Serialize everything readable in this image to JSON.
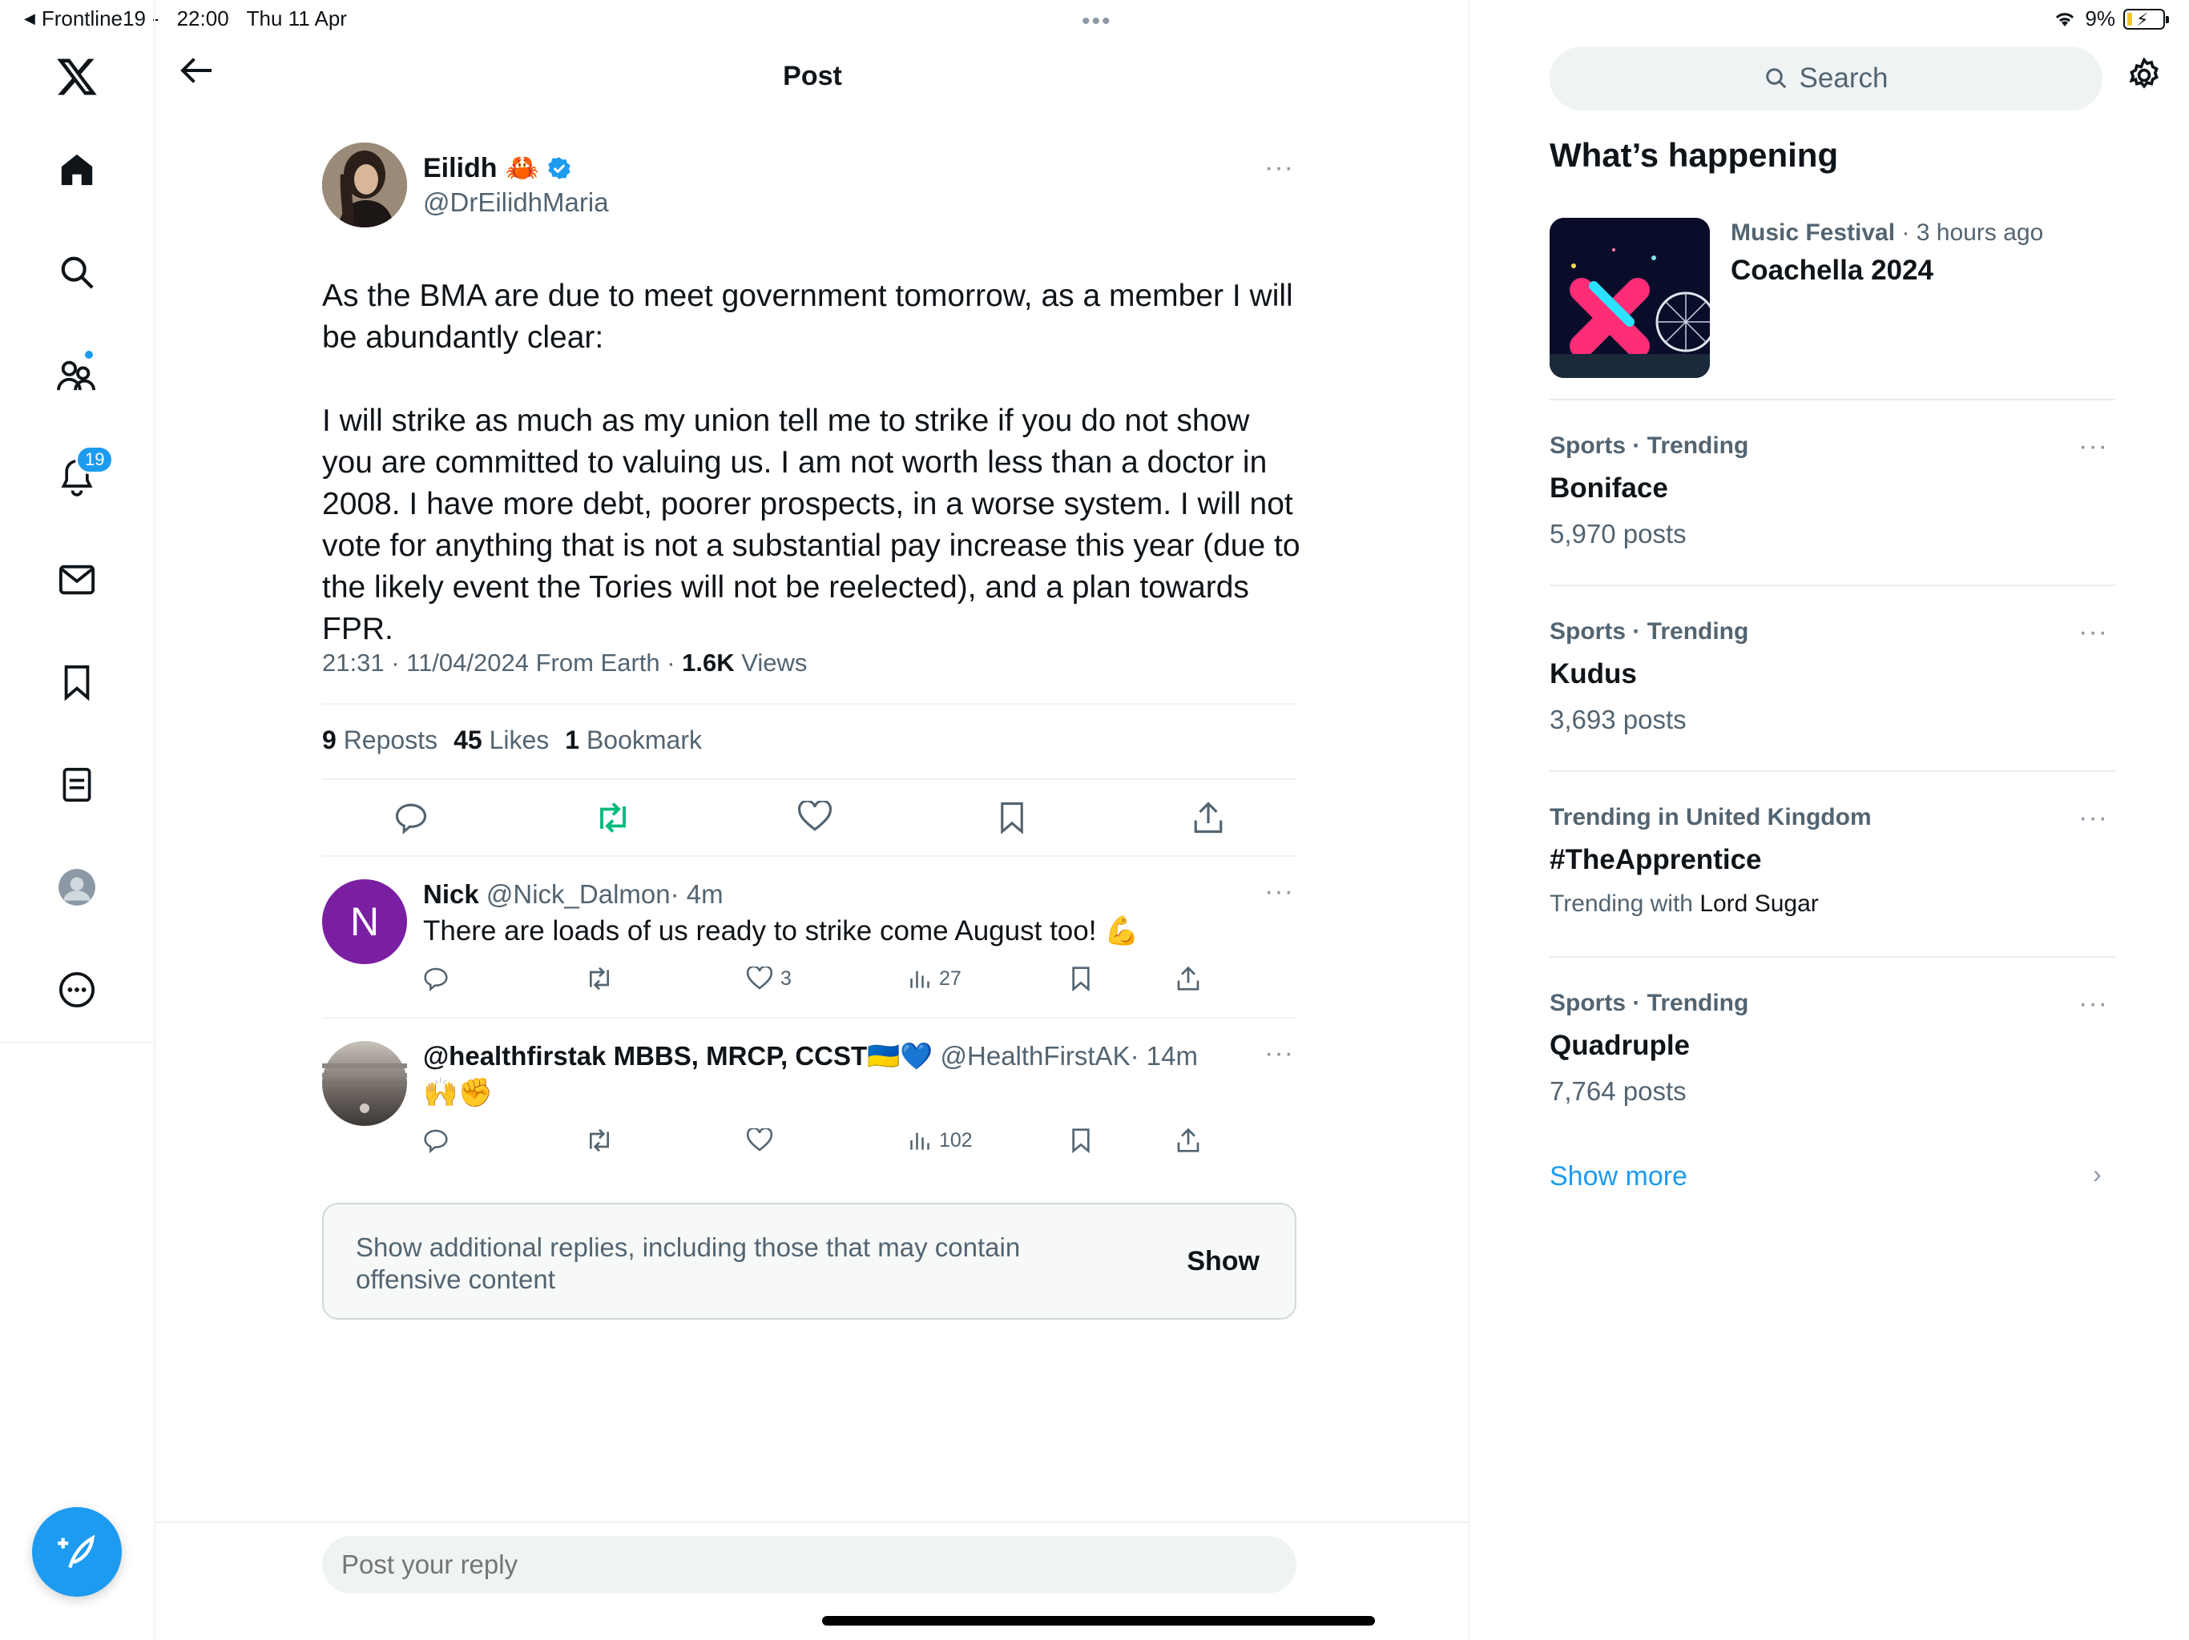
{
  "status_bar": {
    "back_app": "Frontline19",
    "separator": "-",
    "time": "22:00",
    "date": "Thu 11 Apr",
    "battery": "9%"
  },
  "nav": {
    "notifications_badge": "19"
  },
  "header": {
    "title": "Post"
  },
  "post": {
    "author_name": "Eilidh",
    "author_emoji": "🦀",
    "author_handle": "@DrEilidhMaria",
    "paragraphs": [
      "As the BMA are due to meet government tomorrow, as a member I will be abundantly clear:",
      "I will strike as much as my union tell me to strike if you do not show you are committed to valuing us. I am not worth less than a doctor in 2008. I have more debt, poorer prospects, in a worse system. I will not vote for anything that is not a substantial pay increase this year (due to the likely event the Tories will not be reelected), and a plan towards FPR."
    ],
    "meta_time": "21:31 · 11/04/2024 From Earth · ",
    "meta_views": "1.6K",
    "meta_views_label": " Views",
    "reposts_count": "9",
    "reposts_label": "Reposts",
    "likes_count": "45",
    "likes_label": "Likes",
    "bookmarks_count": "1",
    "bookmarks_label": "Bookmark"
  },
  "replies": [
    {
      "initial": "N",
      "name": "Nick",
      "handle": "@Nick_Dalmon",
      "time": "· 4m",
      "text": "There are loads of us ready to strike come August too! 💪",
      "likes": "3",
      "views": "27"
    },
    {
      "name": "@healthfirstak MBBS, MRCP, CCST🇺🇦💙",
      "handle": "@HealthFirstAK",
      "time": "· 14m",
      "text": "🙌✊",
      "likes": "",
      "views": "102"
    }
  ],
  "show_additional": {
    "text": "Show additional replies, including those that may contain offensive content",
    "button": "Show"
  },
  "reply_input": {
    "placeholder": "Post your reply"
  },
  "sidebar": {
    "search_placeholder": "Search",
    "whats_happening": "What’s happening",
    "featured": {
      "category": "Music Festival",
      "time": " · 3 hours ago",
      "title": "Coachella 2024"
    },
    "trends": [
      {
        "category": "Sports · Trending",
        "name": "Boniface",
        "count": "5,970 posts"
      },
      {
        "category": "Sports · Trending",
        "name": "Kudus",
        "count": "3,693 posts"
      },
      {
        "category": "Trending in United Kingdom",
        "name": "#TheApprentice",
        "with_label": "Trending with ",
        "with_name": "Lord Sugar"
      },
      {
        "category": "Sports · Trending",
        "name": "Quadruple",
        "count": "7,764 posts"
      }
    ],
    "show_more": "Show more"
  },
  "colors": {
    "accent": "#1d9bf0",
    "repost_green": "#00ba7c",
    "text_primary": "#0f1419",
    "text_secondary": "#536471"
  }
}
